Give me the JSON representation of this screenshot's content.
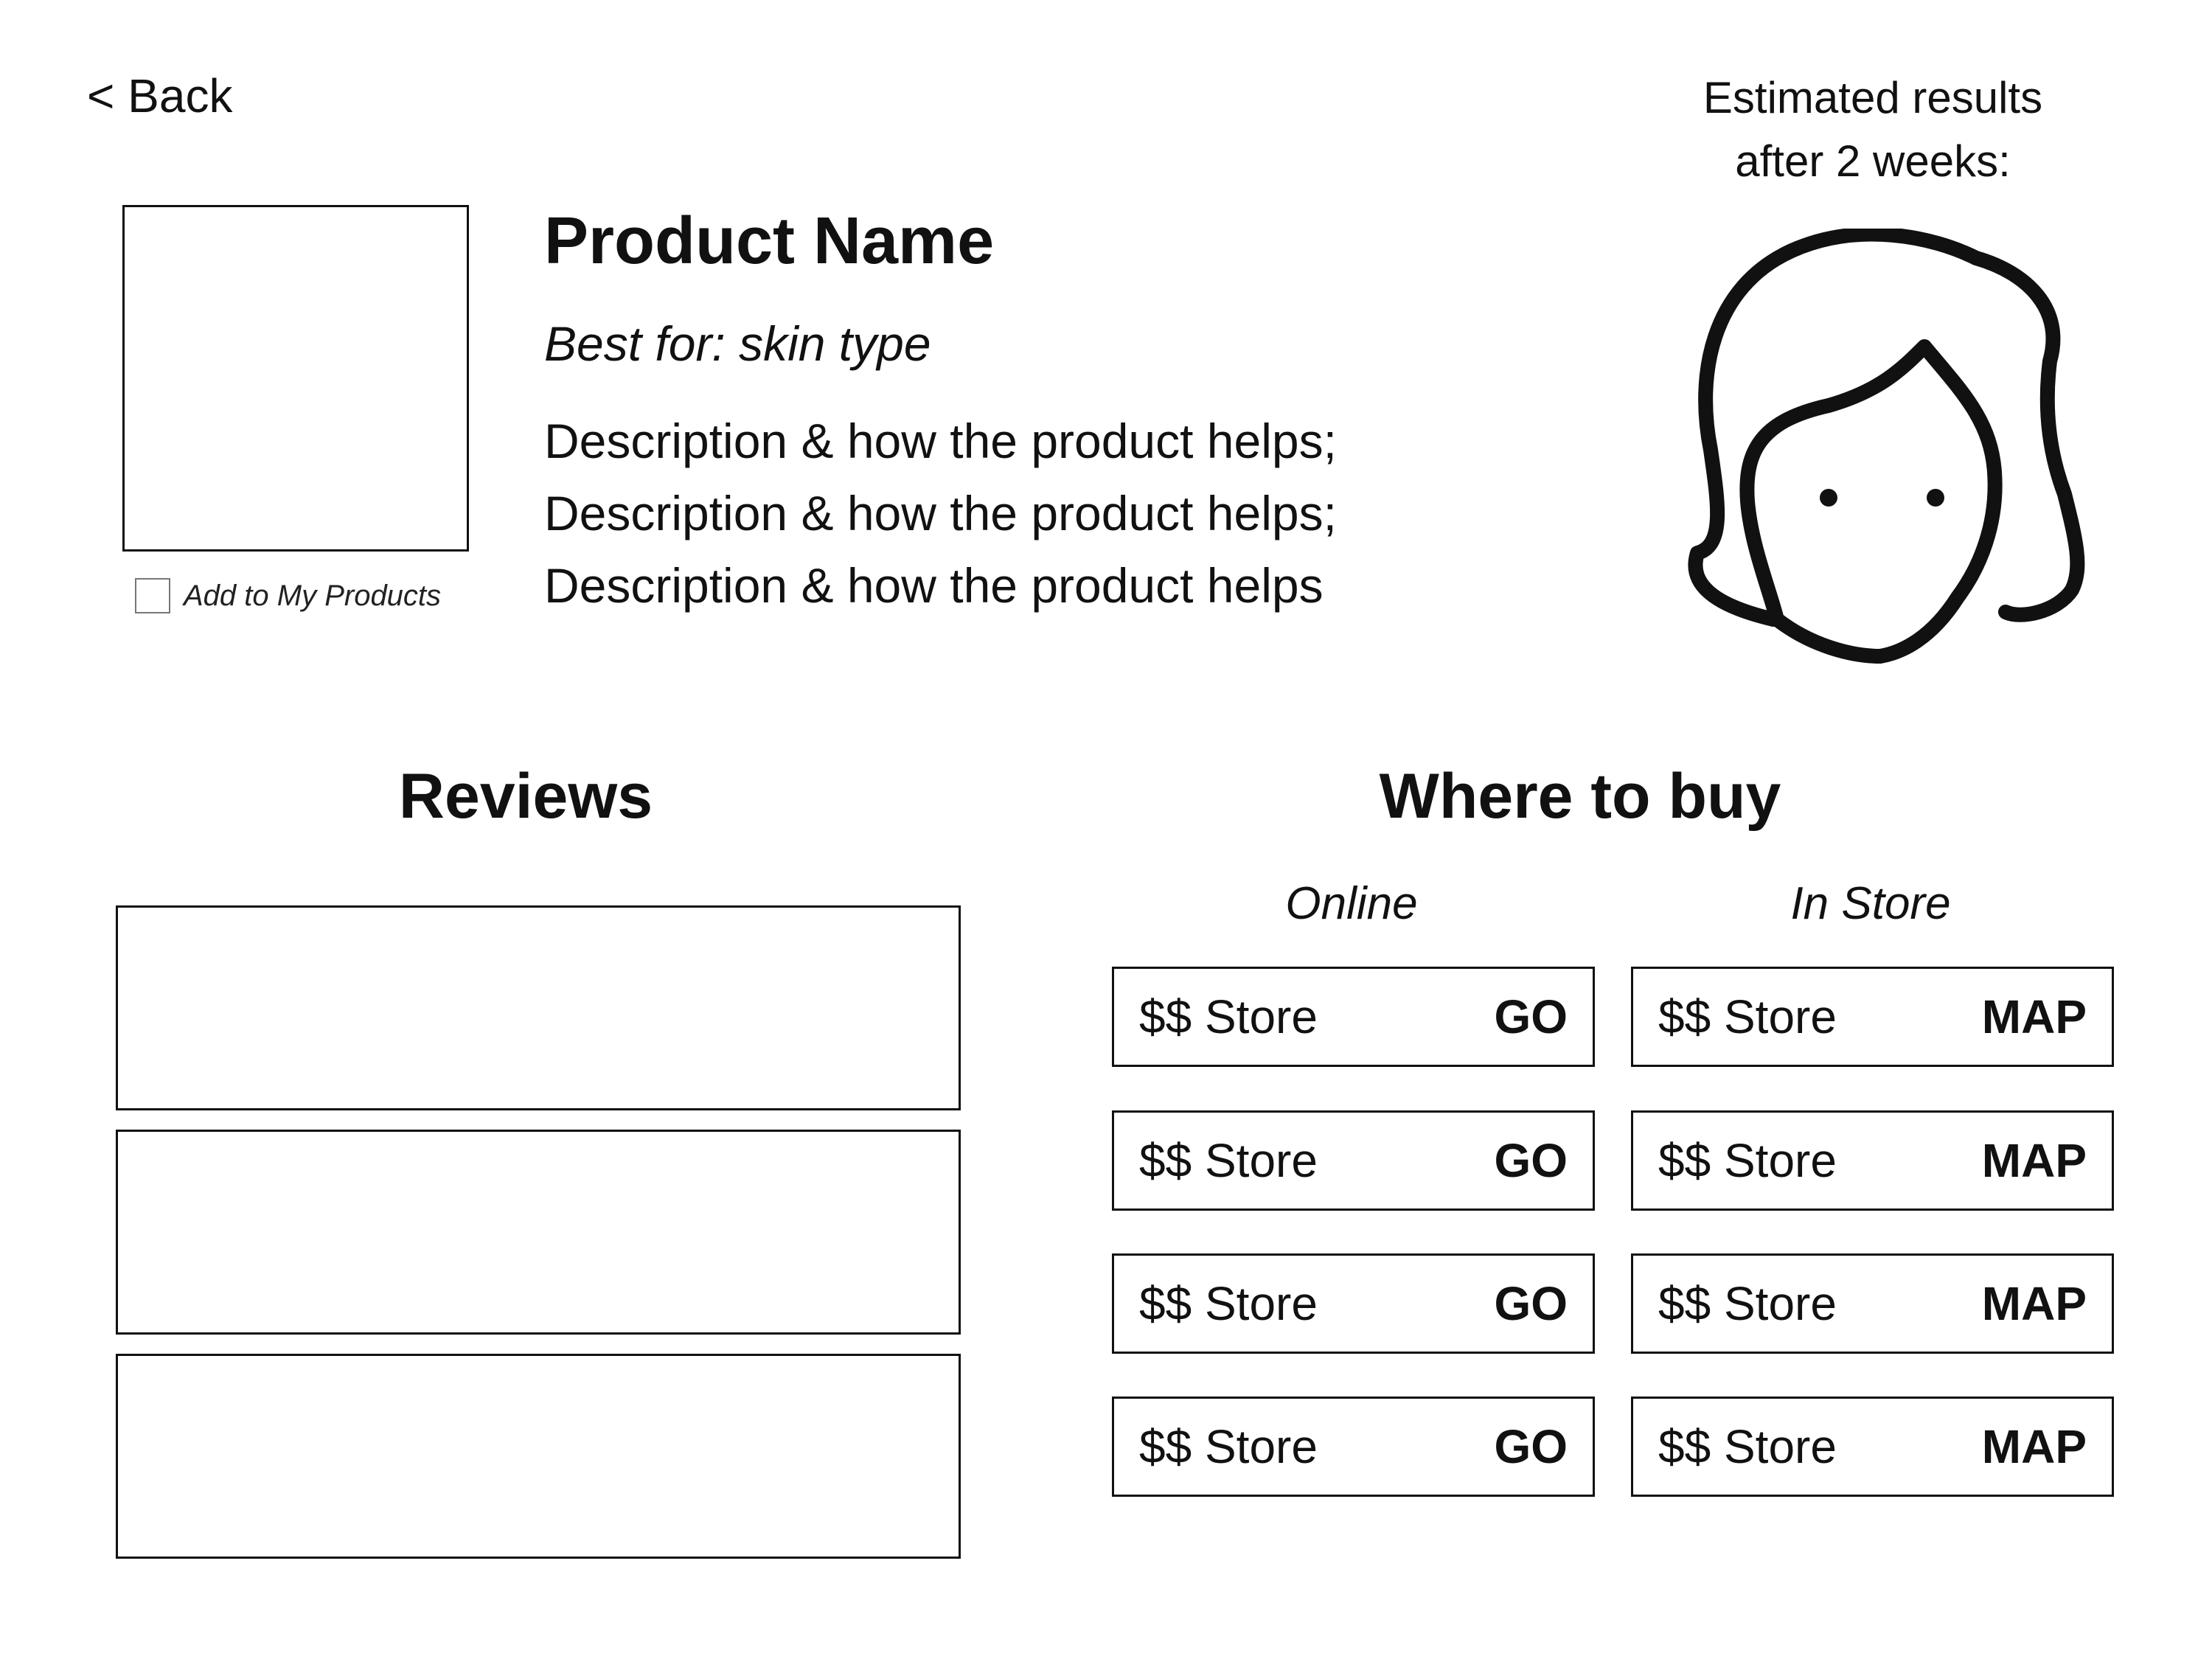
{
  "nav": {
    "back_label": "< Back"
  },
  "product": {
    "add_label": "Add to My Products",
    "name": "Product Name",
    "best_for": "Best for: skin type",
    "description_lines": [
      "Description & how the product helps;",
      "Description & how the product helps;",
      "Description & how the product helps"
    ]
  },
  "results": {
    "title_line1": "Estimated results",
    "title_line2": "after 2 weeks:",
    "icon": "woman-face-icon"
  },
  "reviews": {
    "heading": "Reviews"
  },
  "where_to_buy": {
    "heading": "Where to buy",
    "online_label": "Online",
    "in_store_label": "In Store",
    "online": [
      {
        "store": "$$ Store",
        "action": "GO"
      },
      {
        "store": "$$ Store",
        "action": "GO"
      },
      {
        "store": "$$ Store",
        "action": "GO"
      },
      {
        "store": "$$ Store",
        "action": "GO"
      }
    ],
    "in_store": [
      {
        "store": "$$ Store",
        "action": "MAP"
      },
      {
        "store": "$$ Store",
        "action": "MAP"
      },
      {
        "store": "$$ Store",
        "action": "MAP"
      },
      {
        "store": "$$ Store",
        "action": "MAP"
      }
    ]
  }
}
